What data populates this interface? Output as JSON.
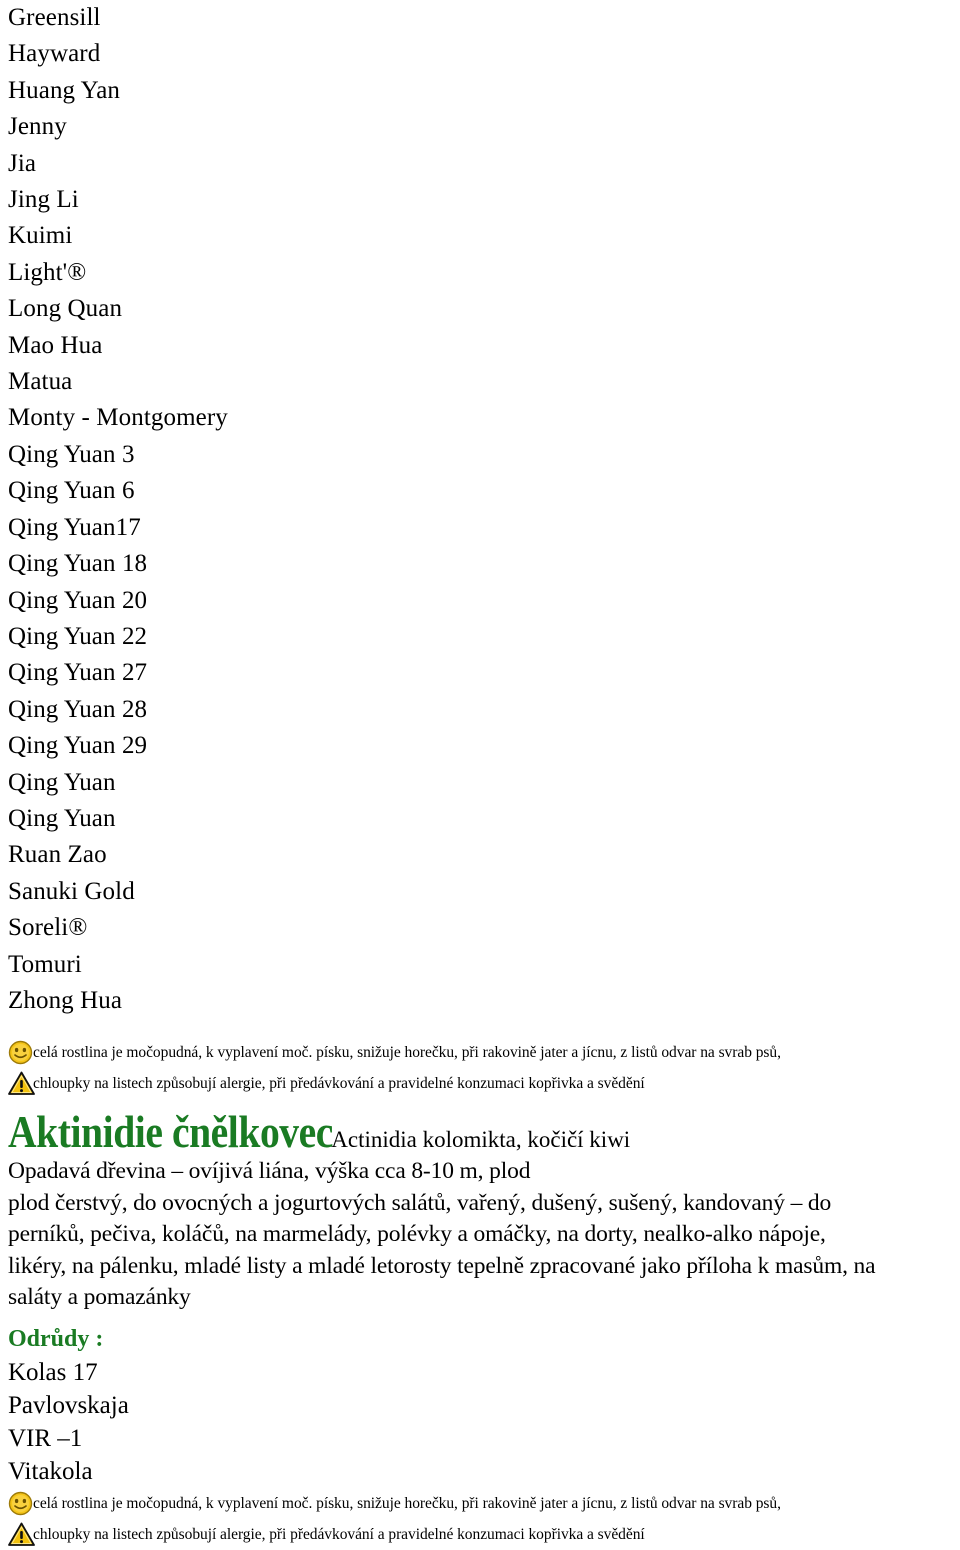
{
  "page": {
    "title_cz": "Aktinidie čnělkovec",
    "title_latin": "Actinidia kolomikta, kočičí kiwi",
    "colors": {
      "heading_green": "#1a7b23",
      "body_black": "#000000",
      "icon_yellow": "#F2C10D",
      "page_background": "#FFFFFF"
    }
  },
  "cultivar_list": {
    "items": [
      "Greensill",
      "Hayward",
      "Huang Yan",
      "Jenny",
      "Jia",
      "Jing Li",
      "Kuimi",
      "Light'®",
      "Long Quan",
      "Mao Hua",
      "Matua",
      "Monty - Montgomery",
      "Qing Yuan 3",
      "Qing Yuan 6",
      "Qing Yuan17",
      "Qing Yuan 18",
      "Qing Yuan 20",
      "Qing Yuan 22",
      "Qing Yuan 27",
      "Qing Yuan 28",
      "Qing Yuan 29",
      "Qing Yuan",
      "Qing Yuan",
      "Ruan Zao",
      "Sanuki Gold",
      "Soreli®",
      "Tomuri",
      "Zhong Hua"
    ]
  },
  "notes_top": {
    "benefit_icon": "smiley-face-icon",
    "benefit_text": "celá rostlina je močopudná, k vyplavení moč. písku, snižuje horečku, při rakovině jater a jícnu, z listů odvar na svrab psů,",
    "warning_icon": "warning-triangle-icon",
    "warning_text": "chloupky na listech způsobují alergie, při předávkování a pravidelné konzumaci kopřivka a svědění"
  },
  "description": {
    "lines": [
      "Opadavá dřevina – ovíjivá liána, výška cca 8-10 m, plod",
      "plod čerstvý, do ovocných a jogurtových salátů, vařený, dušený, sušený, kandovaný – do",
      "perníků,  pečiva, koláčů, na marmelády, polévky a omáčky, na dorty, nealko-alko nápoje,",
      "likéry, na pálenku, mladé listy a mladé letorosty tepelně zpracované jako příloha k masům, na",
      "saláty a pomazánky"
    ]
  },
  "varieties": {
    "title": "Odrůdy :",
    "items": [
      "Kolas 17",
      "Pavlovskaja",
      "VIR –1",
      "Vitakola"
    ]
  },
  "notes_bottom": {
    "benefit_icon": "smiley-face-icon",
    "benefit_text": "celá rostlina je močopudná, k vyplavení moč. písku, snižuje horečku, při rakovině jater a jícnu, z listů odvar na svrab psů,",
    "warning_icon": "warning-triangle-icon",
    "warning_text": "chloupky na listech způsobují alergie, při předávkování a pravidelné konzumaci kopřivka a svědění"
  }
}
